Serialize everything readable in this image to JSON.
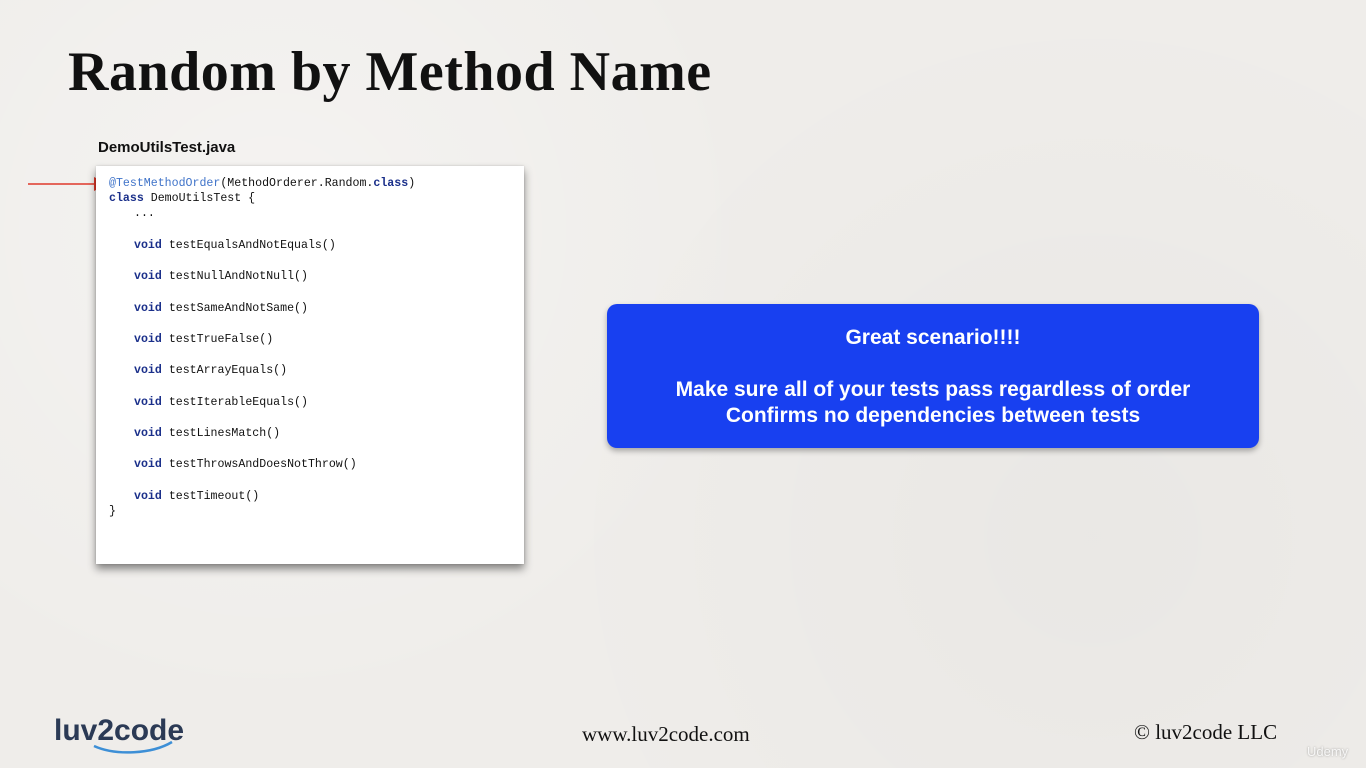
{
  "slide": {
    "title": "Random by Method Name"
  },
  "file_label": "DemoUtilsTest.java",
  "code": {
    "annotation": "@TestMethodOrder",
    "annotation_args": "(MethodOrderer.Random.",
    "class_keyword": "class",
    "annotation_close": ")",
    "class_decl_keyword": "class",
    "class_decl_rest": " DemoUtilsTest {",
    "ellipsis": "...",
    "void_keyword": "void",
    "methods": [
      "testEqualsAndNotEquals()",
      "testNullAndNotNull()",
      "testSameAndNotSame()",
      "testTrueFalse()",
      "testArrayEquals()",
      "testIterableEquals()",
      "testLinesMatch()",
      "testThrowsAndDoesNotThrow()",
      "testTimeout()"
    ],
    "closing_brace": "}"
  },
  "callout": {
    "heading": "Great scenario!!!!",
    "lines": [
      "Make sure all of your tests pass regardless of order",
      "Confirms no dependencies between tests"
    ]
  },
  "footer": {
    "logo_text": "luv2code",
    "url": "www.luv2code.com",
    "copyright": "© luv2code LLC"
  },
  "watermark": "Udemy",
  "colors": {
    "callout_bg": "#1840f0",
    "arrow": "#e0392a",
    "keyword": "#1a2f8a",
    "annotation": "#3f73c9"
  }
}
